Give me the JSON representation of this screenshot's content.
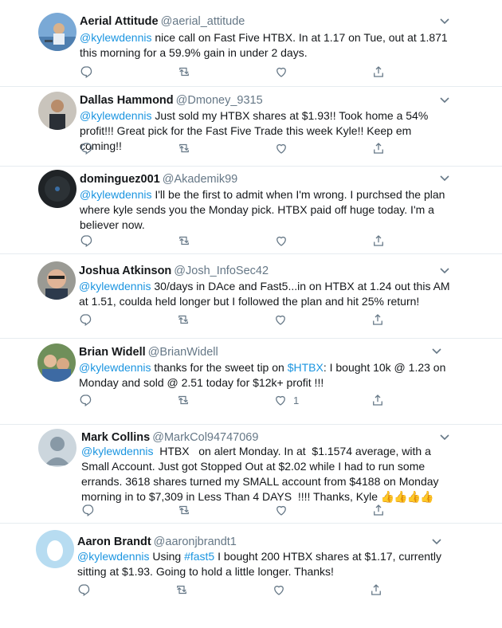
{
  "colors": {
    "link": "#1b95e0",
    "muted": "#657786",
    "text": "#14171a",
    "divider": "#e6ecf0"
  },
  "action_icons": [
    "reply-icon",
    "retweet-icon",
    "like-icon",
    "share-icon"
  ],
  "tweets": [
    {
      "name": "Aerial Attitude",
      "handle": "@aerial_attitude",
      "mention": "@kylewdennis",
      "text": " nice call on Fast Five HTBX. In at 1.17 on Tue, out at 1.871 this morning for a 59.9% gain in under 2 days.",
      "like_count": ""
    },
    {
      "name": "Dallas Hammond",
      "handle": "@Dmoney_9315",
      "mention": "@kylewdennis",
      "text": " Just sold my HTBX shares at $1.93!! Took home a 54% profit!!! Great pick for the Fast Five Trade this week Kyle!! Keep em coming!!",
      "like_count": ""
    },
    {
      "name": "dominguez001",
      "handle": "@Akademik99",
      "mention": "@kylewdennis",
      "text": " I'll be the first to admit when I'm wrong. I purchsed the plan where kyle sends you the Monday pick. HTBX paid off huge today. I'm a believer now.",
      "like_count": ""
    },
    {
      "name": "Joshua Atkinson",
      "handle": "@Josh_InfoSec42",
      "mention": "@kylewdennis",
      "text": " 30/days in DAce and Fast5...in on HTBX at 1.24 out this AM at 1.51, coulda held longer but I followed the plan and hit 25% return!",
      "like_count": ""
    },
    {
      "name": "Brian Widell",
      "handle": "@BrianWidell",
      "mention": "@kylewdennis",
      "text_pre": " thanks for the sweet tip on ",
      "highlight": "$HTBX",
      "text": ": I bought 10k @ 1.23 on Monday and sold @ 2.51 today for $12k+ profit !!!",
      "like_count": "1"
    },
    {
      "name": "Mark Collins",
      "handle": "@MarkCol94747069",
      "mention": "@kylewdennis",
      "text": "  HTBX   on alert Monday. In at  $1.1574 average, with a Small Account. Just got Stopped Out at $2.02 while I had to run some errands. 3618 shares turned my SMALL account from $4188 on Monday morning in to $7,309 in Less Than 4 DAYS  !!!! Thanks, Kyle ",
      "emoji": "👍👍👍👍",
      "like_count": ""
    },
    {
      "name": "Aaron Brandt",
      "handle": "@aaronjbrandt1",
      "mention": "@kylewdennis",
      "text_pre": " Using ",
      "highlight": "#fast5",
      "text": " I bought 200 HTBX shares at $1.17, currently sitting at $1.93. Going to hold a little longer. Thanks!",
      "like_count": ""
    }
  ]
}
